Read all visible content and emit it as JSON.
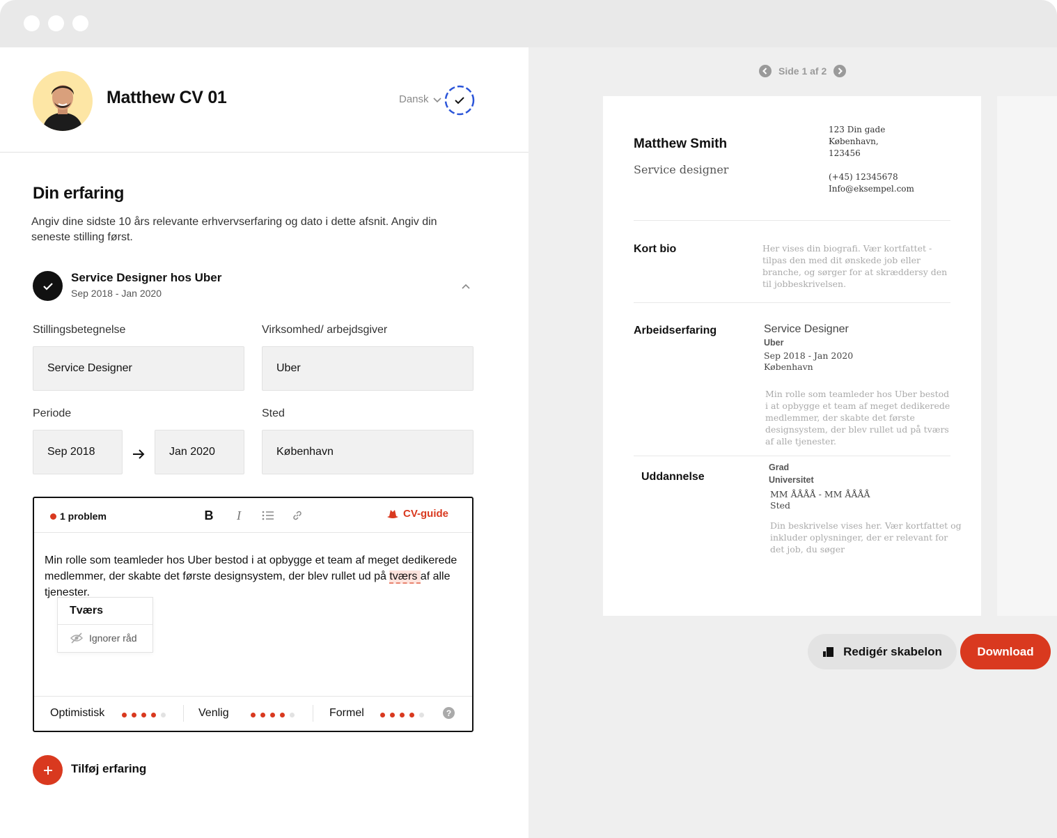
{
  "header": {
    "cv_title": "Matthew CV 01",
    "language": "Dansk"
  },
  "section": {
    "title": "Din erfaring",
    "description": "Angiv dine sidste 10 års relevante erhvervserfaring og dato i dette afsnit. Angiv din seneste stilling først."
  },
  "job": {
    "title": "Service Designer hos Uber",
    "dates": "Sep 2018 - Jan 2020"
  },
  "form": {
    "job_title_label": "Stillingsbetegnelse",
    "job_title_value": "Service Designer",
    "employer_label": "Virksomhed/ arbejdsgiver",
    "employer_value": "Uber",
    "period_label": "Periode",
    "start_value": "Sep 2018",
    "end_value": "Jan 2020",
    "location_label": "Sted",
    "location_value": "København"
  },
  "editor": {
    "problem_count": "1 problem",
    "bold_label": "B",
    "italic_label": "I",
    "cv_guide": "CV-guide",
    "text_before": "Min rolle som teamleder hos Uber bestod i at opbygge et team af meget dedikerede medlemmer, der skabte det første designsystem, der blev rullet ud på ",
    "misspelled": "tværs ",
    "text_after": "af alle tjenester.",
    "suggestion": "Tværs",
    "ignore": "Ignorer råd",
    "tones": [
      {
        "label": "Optimistisk",
        "level": 4,
        "max": 5
      },
      {
        "label": "Venlig",
        "level": 4,
        "max": 5
      },
      {
        "label": "Formel",
        "level": 4,
        "max": 5
      }
    ],
    "help": "?"
  },
  "add_experience": "Tilføj erfaring",
  "preview": {
    "pager": "Side 1 af 2",
    "name": "Matthew Smith",
    "role": "Service designer",
    "address1": "123 Din gade",
    "address2": "København,",
    "address3": "123456",
    "phone": "(+45) 12345678",
    "email": "Info@eksempel.com",
    "bio_heading": "Kort bio",
    "bio_text": "Her vises din biografi. Vær kortfattet - tilpas den med dit ønskede job eller branche, og sørger for at skræddersy den til jobbeskrivelsen.",
    "exp_heading": "Arbeidserfaring",
    "exp_title": "Service Designer",
    "exp_company": "Uber",
    "exp_dates": "Sep 2018 - Jan 2020",
    "exp_city": "København",
    "exp_desc": "Min rolle som teamleder hos Uber bestod i at opbygge et team af meget dedikerede medlemmer, der skabte det første designsystem, der blev rullet ud på tværs af alle tjenester.",
    "edu_heading": "Uddannelse",
    "edu_degree": "Grad",
    "edu_school": "Universitet",
    "edu_dates": "MM ÅÅÅÅ - MM ÅÅÅÅ",
    "edu_place": "Sted",
    "edu_desc": "Din beskrivelse vises her. Vær kortfattet og inkluder oplysninger, der er relevant for det job, du søger"
  },
  "actions": {
    "edit_template": "Redigér skabelon",
    "download": "Download"
  },
  "colors": {
    "accent": "#d9391f",
    "avatar_bg": "#fde6a5",
    "ring": "#2b55d9"
  }
}
